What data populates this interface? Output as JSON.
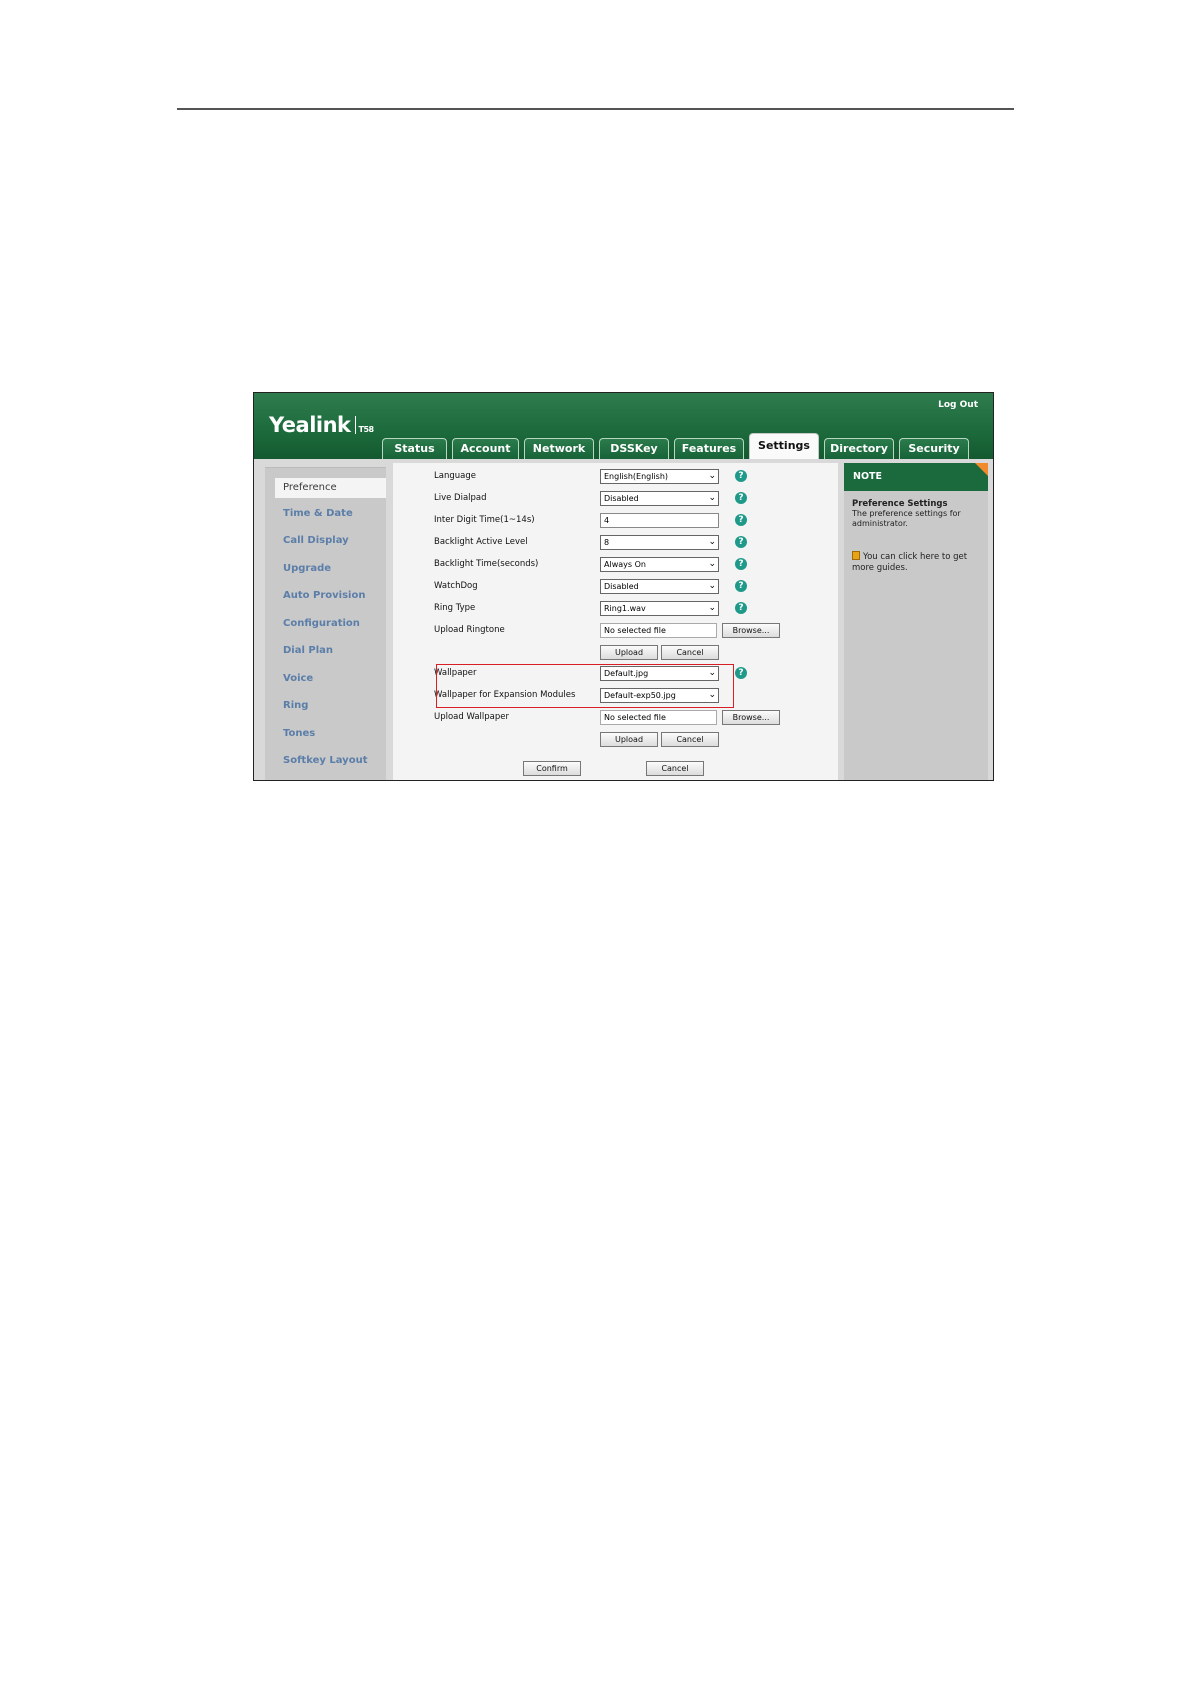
{
  "header": {
    "logo": "Yealink",
    "model": "T58",
    "logout_label": "Log Out"
  },
  "tabs": [
    {
      "label": "Status"
    },
    {
      "label": "Account"
    },
    {
      "label": "Network"
    },
    {
      "label": "DSSKey"
    },
    {
      "label": "Features"
    },
    {
      "label": "Settings",
      "active": true
    },
    {
      "label": "Directory"
    },
    {
      "label": "Security"
    }
  ],
  "sidebar": {
    "items": [
      {
        "label": "Preference",
        "active": true
      },
      {
        "label": "Time & Date"
      },
      {
        "label": "Call Display"
      },
      {
        "label": "Upgrade"
      },
      {
        "label": "Auto Provision"
      },
      {
        "label": "Configuration"
      },
      {
        "label": "Dial Plan"
      },
      {
        "label": "Voice"
      },
      {
        "label": "Ring"
      },
      {
        "label": "Tones"
      },
      {
        "label": "Softkey Layout"
      }
    ]
  },
  "form": {
    "language": {
      "label": "Language",
      "value": "English(English)"
    },
    "live_dialpad": {
      "label": "Live Dialpad",
      "value": "Disabled"
    },
    "inter_digit": {
      "label": "Inter Digit Time(1~14s)",
      "value": "4"
    },
    "backlight_level": {
      "label": "Backlight Active Level",
      "value": "8"
    },
    "backlight_time": {
      "label": "Backlight Time(seconds)",
      "value": "Always On"
    },
    "watchdog": {
      "label": "WatchDog",
      "value": "Disabled"
    },
    "ring_type": {
      "label": "Ring Type",
      "value": "Ring1.wav"
    },
    "upload_ringtone": {
      "label": "Upload Ringtone",
      "file_text": "No selected file",
      "browse": "Browse...",
      "upload": "Upload",
      "cancel": "Cancel"
    },
    "wallpaper": {
      "label": "Wallpaper",
      "value": "Default.jpg"
    },
    "wallpaper_exp": {
      "label": "Wallpaper for Expansion Modules",
      "value": "Default-exp50.jpg"
    },
    "upload_wallpaper": {
      "label": "Upload Wallpaper",
      "file_text": "No selected file",
      "browse": "Browse...",
      "upload": "Upload",
      "cancel": "Cancel"
    },
    "confirm_label": "Confirm",
    "cancel_label": "Cancel"
  },
  "note": {
    "header": "NOTE",
    "title": "Preference Settings",
    "text": "The preference settings for administrator.",
    "link": "You can click here to get more guides."
  },
  "colors": {
    "brand_green": "#1c6a3c",
    "sidebar_link": "#5b7ea9",
    "help_icon": "#1f9a8a",
    "highlight_box": "#d81f26",
    "note_corner": "#f08a2a"
  }
}
